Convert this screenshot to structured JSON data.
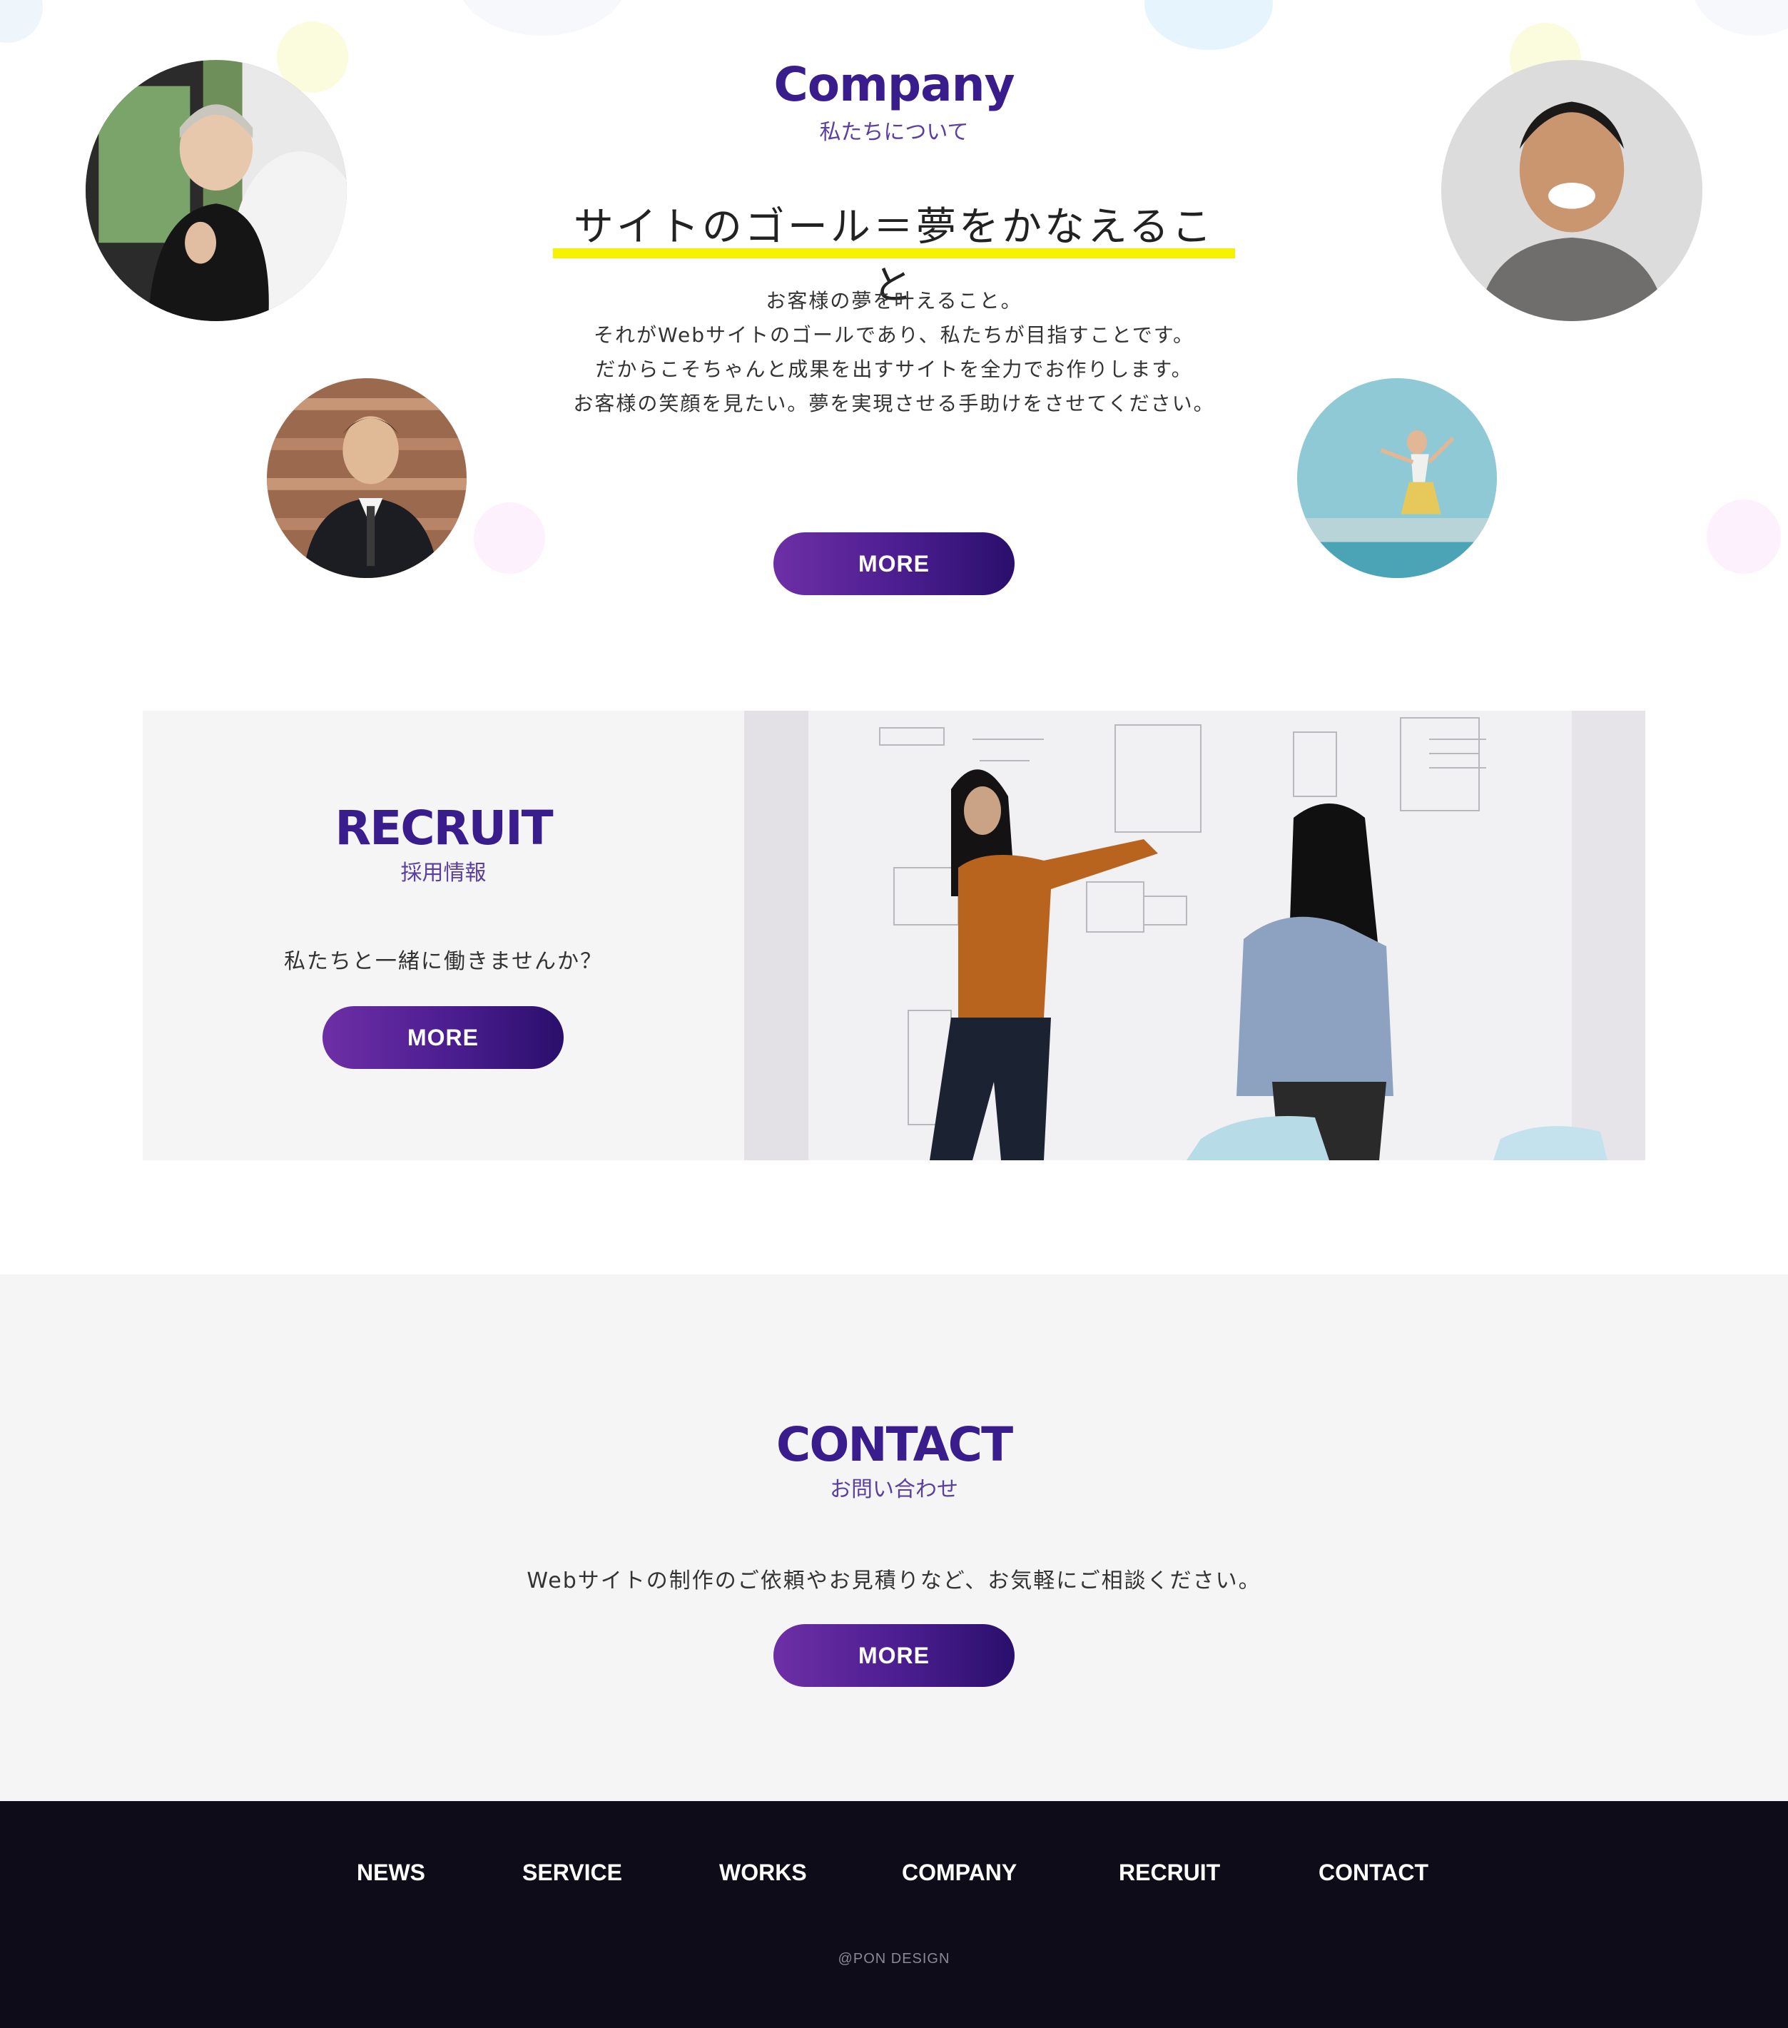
{
  "company": {
    "title": "Company",
    "subtitle": "私たちについて",
    "headline": "サイトのゴール＝夢をかなえること",
    "paragraphs": [
      "お客様の夢を叶えること。",
      "それがWebサイトのゴールであり、私たちが目指すことです。",
      "だからこそちゃんと成果を出すサイトを全力でお作りします。",
      "お客様の笑顔を見たい。夢を実現させる手助けをさせてください。"
    ],
    "more_label": "MORE"
  },
  "recruit": {
    "title": "RECRUIT",
    "subtitle": "採用情報",
    "text": "私たちと一緒に働きませんか？",
    "more_label": "MORE"
  },
  "contact": {
    "title": "CONTACT",
    "subtitle": "お問い合わせ",
    "text": "Webサイトの制作のご依頼やお見積りなど、お気軽にご相談ください。",
    "more_label": "MORE"
  },
  "footer": {
    "nav": [
      "NEWS",
      "SERVICE",
      "WORKS",
      "COMPANY",
      "RECRUIT",
      "CONTACT"
    ],
    "copyright": "@PON DESIGN"
  },
  "colors": {
    "accent": "#3a1d8c",
    "highlight": "#f5f200",
    "footer_bg": "#0f0c1a",
    "section_bg": "#f5f5f5"
  }
}
